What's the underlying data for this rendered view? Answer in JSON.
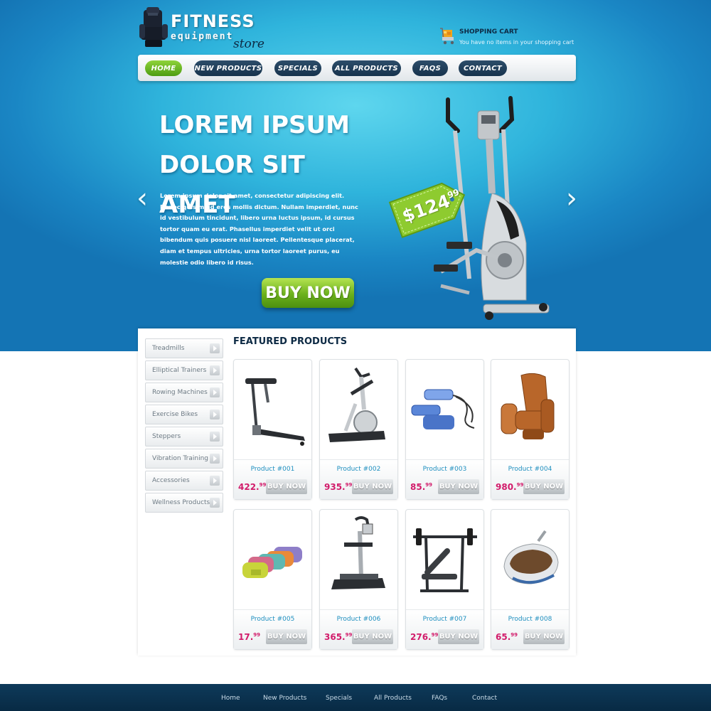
{
  "brand": {
    "line1": "FITNESS",
    "line2": "equipment",
    "line3": "store"
  },
  "cart": {
    "title": "SHOPPING CART",
    "status": "You have no items in your shopping cart"
  },
  "nav": [
    "HOME",
    "NEW PRODUCTS",
    "SPECIALS",
    "ALL PRODUCTS",
    "FAQS",
    "CONTACT"
  ],
  "hero": {
    "title_line1": "LOREM IPSUM",
    "title_line2": "DOLOR SIT AMET",
    "text": "Lorem ipsum dolor sit amet, consectetur adipiscing elit. Donec quis mi id eros mollis dictum. Nullam imperdiet, nunc id vestibulum tincidunt, libero urna luctus ipsum, id cursus tortor quam eu erat. Phasellus imperdiet velit ut orci bibendum quis posuere nisl laoreet. Pellentesque placerat, diam et tempus ultricies, urna tortor laoreet purus, eu molestie odio libero id risus.",
    "price_main": "$124",
    "price_cents": "99",
    "cta": "BUY NOW",
    "prev_arrow": "‹",
    "next_arrow": "›"
  },
  "categories": [
    "Treadmills",
    "Elliptical Trainers",
    "Rowing Machines",
    "Exercise Bikes",
    "Steppers",
    "Vibration Training",
    "Accessories",
    "Wellness Products"
  ],
  "featured_title": "FEATURED PRODUCTS",
  "products": [
    {
      "name": "Product #001",
      "price": "422.",
      "cents": "99",
      "button": "BUY NOW",
      "icon": "treadmill-icon"
    },
    {
      "name": "Product #002",
      "price": "935.",
      "cents": "99",
      "button": "BUY NOW",
      "icon": "stepper-machine-icon"
    },
    {
      "name": "Product #003",
      "price": "85.",
      "cents": "99",
      "button": "BUY NOW",
      "icon": "mini-stepper-icon"
    },
    {
      "name": "Product #004",
      "price": "980.",
      "cents": "99",
      "button": "BUY NOW",
      "icon": "massage-chair-icon"
    },
    {
      "name": "Product #005",
      "price": "17.",
      "cents": "99",
      "button": "BUY NOW",
      "icon": "dumbbells-icon"
    },
    {
      "name": "Product #006",
      "price": "365.",
      "cents": "99",
      "button": "BUY NOW",
      "icon": "vibration-plate-icon"
    },
    {
      "name": "Product #007",
      "price": "276.",
      "cents": "99",
      "button": "BUY NOW",
      "icon": "weight-bench-icon"
    },
    {
      "name": "Product #008",
      "price": "65.",
      "cents": "99",
      "button": "BUY NOW",
      "icon": "foot-massager-icon"
    }
  ],
  "footer": [
    "Home",
    "New Products",
    "Specials",
    "All Products",
    "FAQs",
    "Contact"
  ]
}
